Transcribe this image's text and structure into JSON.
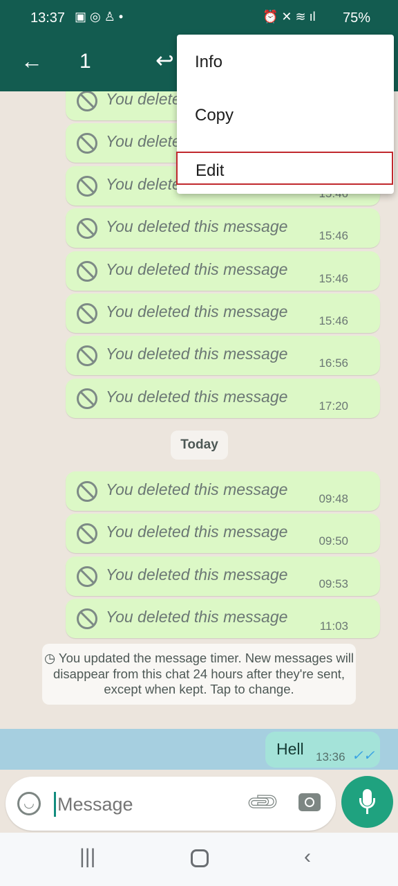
{
  "status": {
    "time": "13:37",
    "left_icons": [
      "gallery-icon",
      "whatsapp-icon",
      "accessibility-icon",
      "dot-icon"
    ],
    "right_icons": [
      "alarm-icon",
      "mute-icon",
      "wifi-icon",
      "signal-icon"
    ],
    "battery": "75%"
  },
  "appbar": {
    "selected_count": "1"
  },
  "menu": {
    "items": [
      {
        "label": "Info"
      },
      {
        "label": "Copy"
      },
      {
        "label": "Edit"
      }
    ],
    "highlighted": "Edit",
    "highlight_color": "#c0282d"
  },
  "messages": [
    {
      "text": "You deleted this message",
      "time": ""
    },
    {
      "text": "You deleted this message",
      "time": ""
    },
    {
      "text": "You deleted this message",
      "time": "15:46"
    },
    {
      "text": "You deleted this message",
      "time": "15:46"
    },
    {
      "text": "You deleted this message",
      "time": "15:46"
    },
    {
      "text": "You deleted this message",
      "time": "15:46"
    },
    {
      "text": "You deleted this message",
      "time": "16:56"
    },
    {
      "text": "You deleted this message",
      "time": "17:20"
    }
  ],
  "date_divider": "Today",
  "today_messages": [
    {
      "text": "You deleted this message",
      "time": "09:48"
    },
    {
      "text": "You deleted this message",
      "time": "09:50"
    },
    {
      "text": "You deleted this message",
      "time": "09:53"
    },
    {
      "text": "You deleted this message",
      "time": "11:03"
    }
  ],
  "notice": "You updated the message timer. New messages will disappear from this chat 24 hours after they're sent, except when kept. Tap to change.",
  "selected_message": {
    "text": "Hell",
    "time": "13:36",
    "status": "read"
  },
  "composer": {
    "placeholder": "Message"
  },
  "colors": {
    "header": "#135c50",
    "bubble_out": "#dcf8c6",
    "mic": "#1fa27f",
    "selection": "#a6cfe0"
  }
}
